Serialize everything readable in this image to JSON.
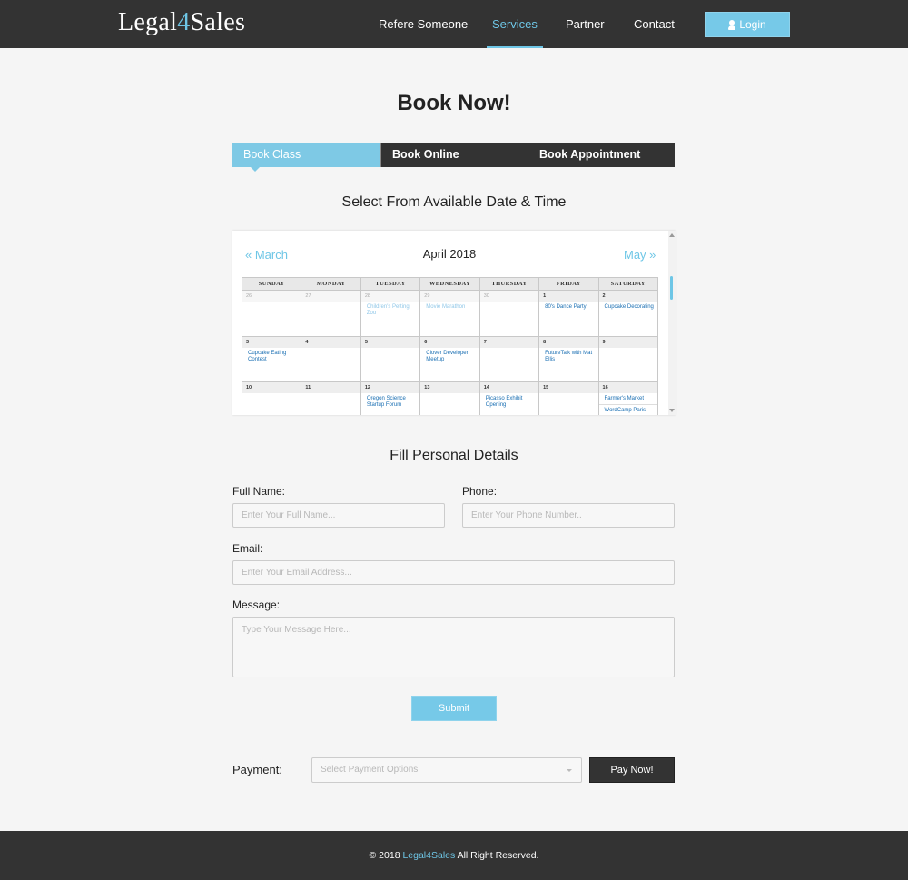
{
  "header": {
    "logo_pre": "Legal",
    "logo_num": "4",
    "logo_post": "Sales",
    "nav": [
      "Refere Someone",
      "Services",
      "Partner",
      "Contact"
    ],
    "active_nav": "Services",
    "login_label": "Login",
    "login_icon": "user-icon"
  },
  "page_title": "Book Now!",
  "tabs": [
    "Book Class",
    "Book Online",
    "Book Appointment"
  ],
  "calendar": {
    "heading": "Select From Available Date & Time",
    "prev_label": "« March",
    "month_title": "April 2018",
    "next_label": "May »",
    "weekdays": [
      "SUNDAY",
      "MONDAY",
      "TUESDAY",
      "WEDNESDAY",
      "THURSDAY",
      "FRIDAY",
      "SATURDAY"
    ],
    "weeks": [
      [
        {
          "day": "26",
          "other": true,
          "events": []
        },
        {
          "day": "27",
          "other": true,
          "events": []
        },
        {
          "day": "28",
          "other": true,
          "events": [
            "Children's Petting Zoo"
          ]
        },
        {
          "day": "29",
          "other": true,
          "events": [
            "Movie Marathon"
          ]
        },
        {
          "day": "30",
          "other": true,
          "events": []
        },
        {
          "day": "1",
          "other": false,
          "events": [
            "80's Dance Party"
          ]
        },
        {
          "day": "2",
          "other": false,
          "events": [
            "Cupcake Decorating"
          ]
        }
      ],
      [
        {
          "day": "3",
          "other": false,
          "events": [
            "Cupcake Eating Contest"
          ]
        },
        {
          "day": "4",
          "other": false,
          "events": []
        },
        {
          "day": "5",
          "other": false,
          "events": []
        },
        {
          "day": "6",
          "other": false,
          "events": [
            "Clover Developer Meetup"
          ]
        },
        {
          "day": "7",
          "other": false,
          "events": []
        },
        {
          "day": "8",
          "other": false,
          "events": [
            "FutureTalk with Mat Ellis"
          ]
        },
        {
          "day": "9",
          "other": false,
          "events": []
        }
      ],
      [
        {
          "day": "10",
          "other": false,
          "events": []
        },
        {
          "day": "11",
          "other": false,
          "events": []
        },
        {
          "day": "12",
          "other": false,
          "events": [
            "Oregon Science Startup Forum"
          ]
        },
        {
          "day": "13",
          "other": false,
          "events": []
        },
        {
          "day": "14",
          "other": false,
          "events": [
            "Picasso Exhibit Opening"
          ]
        },
        {
          "day": "15",
          "other": false,
          "events": []
        },
        {
          "day": "16",
          "other": false,
          "events": [
            "Farmer's Market",
            "WordCamp Paris"
          ]
        }
      ]
    ]
  },
  "details": {
    "heading": "Fill Personal Details",
    "full_name_label": "Full Name:",
    "full_name_placeholder": "Enter Your Full Name...",
    "phone_label": "Phone:",
    "phone_placeholder": "Enter Your Phone Number..",
    "email_label": "Email:",
    "email_placeholder": "Enter Your Email Address...",
    "message_label": "Message:",
    "message_placeholder": "Type Your Message Here...",
    "submit_label": "Submit"
  },
  "payment": {
    "label": "Payment:",
    "select_placeholder": "Select Payment Options",
    "pay_label": "Pay Now!"
  },
  "footer": {
    "prefix": "© 2018 ",
    "brand": "Legal4Sales",
    "suffix": " All Right Reserved."
  },
  "colors": {
    "accent": "#76c9e8",
    "dark": "#333333",
    "event_link": "#1a6fb3"
  }
}
